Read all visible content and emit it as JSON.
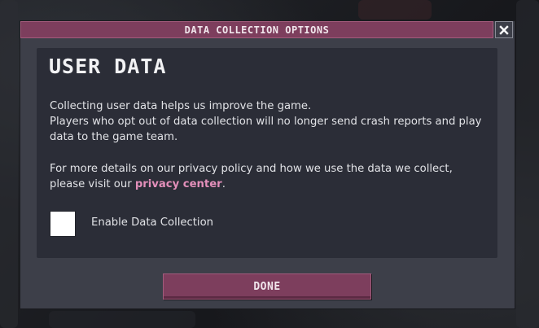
{
  "dialog": {
    "title": "DATA COLLECTION OPTIONS",
    "close_icon": "close-icon"
  },
  "panel": {
    "heading": "USER DATA",
    "paragraph1_line1": "Collecting user data helps us improve the game.",
    "paragraph1_line2": "Players who opt out of data collection will no longer send crash reports and play data to the game team.",
    "paragraph2_text": "For more details on our privacy policy and how we use the data we collect, please visit our ",
    "privacy_link": "privacy center",
    "paragraph2_end": "."
  },
  "checkbox": {
    "label": "Enable Data Collection",
    "checked": false
  },
  "footer": {
    "done_label": "DONE"
  },
  "colors": {
    "accent": "#7d3e5d",
    "link": "#e38fba",
    "panel": "#2b2d37",
    "dialog": "#3d3f49"
  }
}
